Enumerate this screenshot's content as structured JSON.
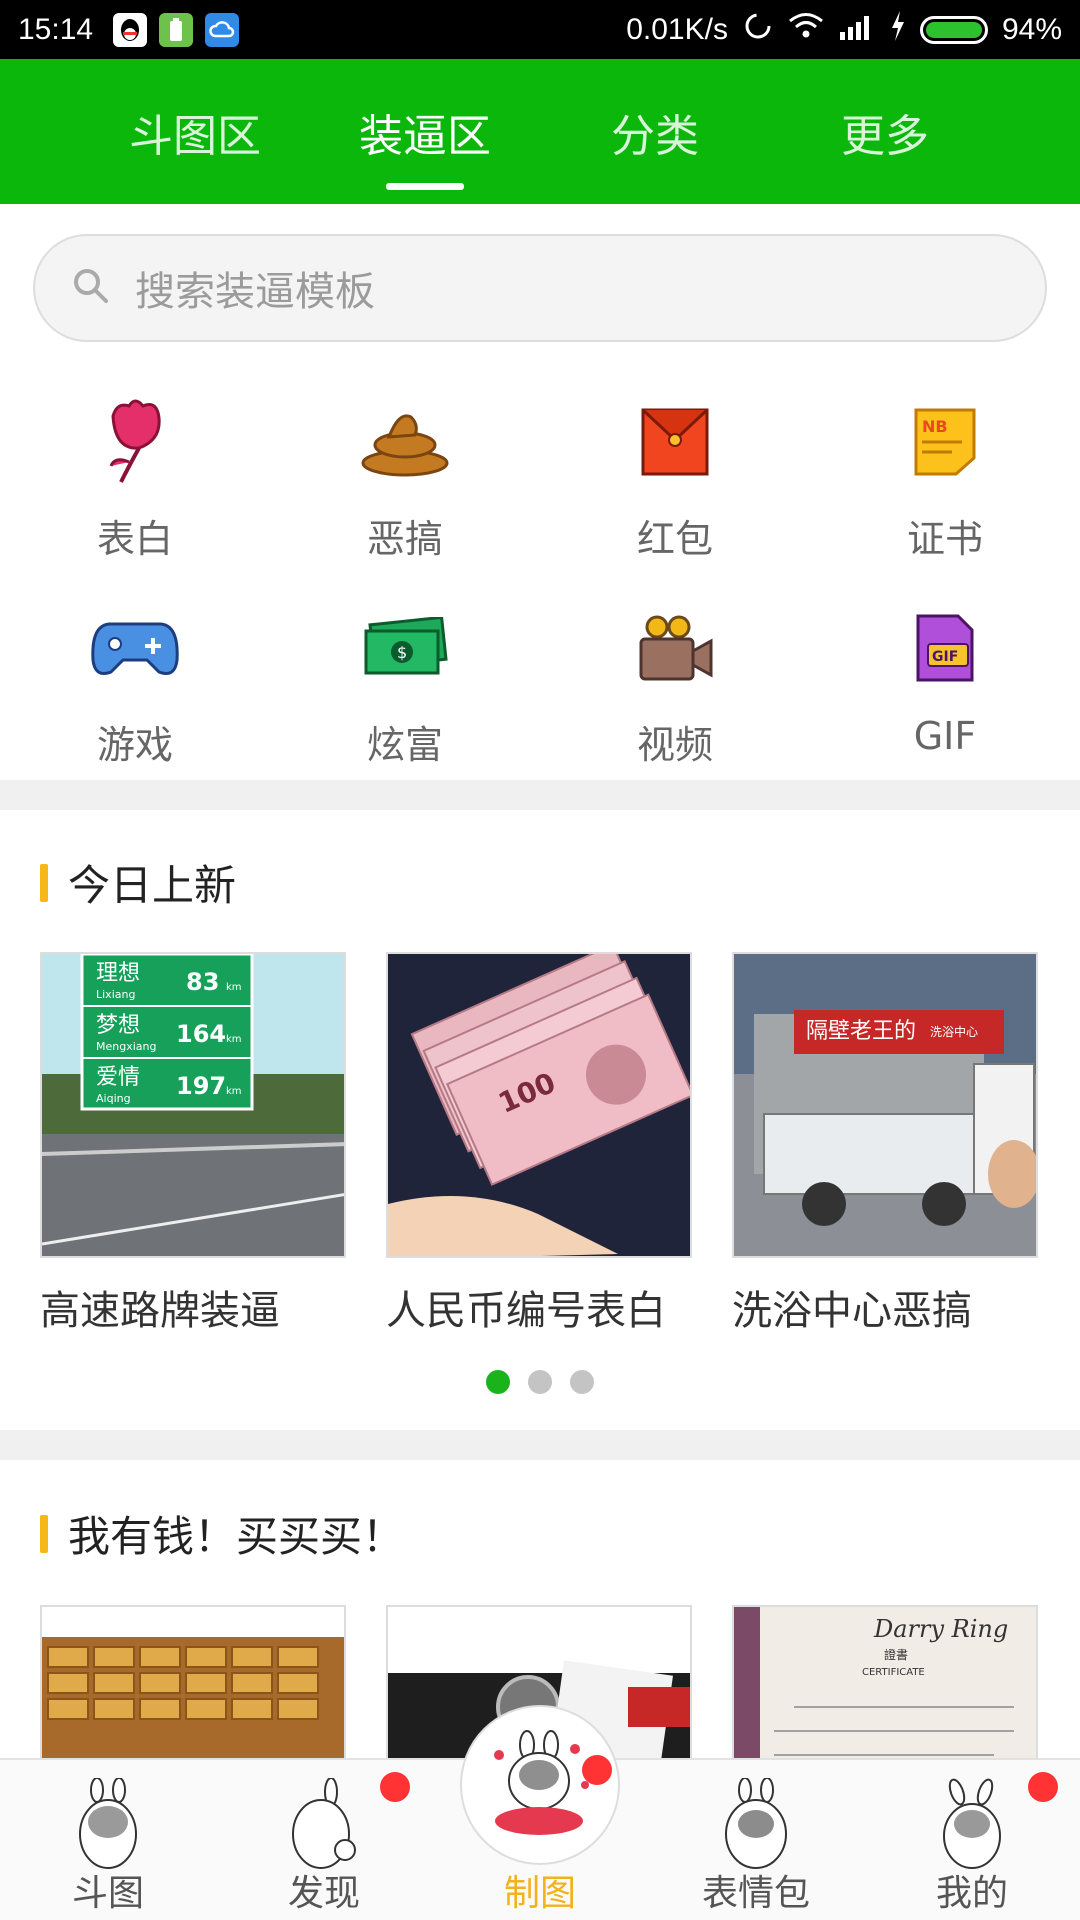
{
  "status_bar": {
    "time": "15:14",
    "net_speed": "0.01K/s",
    "battery": "94%"
  },
  "top_tabs": [
    {
      "label": "斗图区",
      "active": false
    },
    {
      "label": "装逼区",
      "active": true
    },
    {
      "label": "分类",
      "active": false
    },
    {
      "label": "更多",
      "active": false
    }
  ],
  "search": {
    "placeholder": "搜索装逼模板"
  },
  "categories": [
    {
      "label": "表白",
      "icon": "rose-icon"
    },
    {
      "label": "恶搞",
      "icon": "poop-icon"
    },
    {
      "label": "红包",
      "icon": "red-envelope-icon"
    },
    {
      "label": "证书",
      "icon": "certificate-icon"
    },
    {
      "label": "游戏",
      "icon": "gamepad-icon"
    },
    {
      "label": "炫富",
      "icon": "money-icon"
    },
    {
      "label": "视频",
      "icon": "video-camera-icon"
    },
    {
      "label": "GIF",
      "icon": "gif-file-icon"
    }
  ],
  "today_new": {
    "title": "今日上新",
    "items": [
      {
        "caption": "高速路牌装逼",
        "sign_lines": [
          [
            "理想",
            "Lixiang",
            "83"
          ],
          [
            "梦想",
            "Mengxiang",
            "164"
          ],
          [
            "爱情",
            "Aiqing",
            "197"
          ]
        ],
        "unit": "km"
      },
      {
        "caption": "人民币编号表白",
        "note_value": "100"
      },
      {
        "caption": "洗浴中心恶搞",
        "sign_text": "隔壁老王的",
        "sign_sub": "洗浴中心"
      }
    ],
    "page_count": 3,
    "page_active": 0
  },
  "rich_section": {
    "title": "我有钱！买买买！",
    "items": [
      {
        "kind": "gold-bars"
      },
      {
        "kind": "watch-receipt"
      },
      {
        "kind": "certificate",
        "brand": "Darry Ring",
        "heading": "證書",
        "sub": "CERTIFICATE"
      }
    ]
  },
  "bottom_nav": [
    {
      "label": "斗图",
      "active": false,
      "badge": false
    },
    {
      "label": "发现",
      "active": false,
      "badge": true
    },
    {
      "label": "制图",
      "active": true,
      "badge": true
    },
    {
      "label": "表情包",
      "active": false,
      "badge": false
    },
    {
      "label": "我的",
      "active": false,
      "badge": true
    }
  ],
  "colors": {
    "brand_green": "#0cb70c",
    "accent_yellow": "#f6b818",
    "badge_red": "#ff3333"
  }
}
